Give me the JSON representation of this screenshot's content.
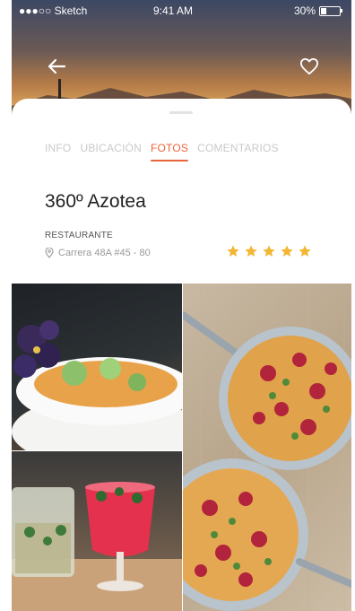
{
  "status_bar": {
    "carrier": "●●●○○ Sketch",
    "time": "9:41 AM",
    "battery": "30%",
    "battery_level": 0.3
  },
  "header": {
    "back_icon": "arrow-left-icon",
    "favorite_icon": "heart-outline-icon"
  },
  "tabs": [
    {
      "label": "INFO",
      "active": false
    },
    {
      "label": "UBICACIÓN",
      "active": false
    },
    {
      "label": "FOTOS",
      "active": true
    },
    {
      "label": "COMENTARIOS",
      "active": false
    }
  ],
  "venue": {
    "name": "360º Azotea",
    "category": "RESTAURANTE",
    "address": "Carrera 48A #45 - 80",
    "rating": 5,
    "rating_max": 5
  },
  "colors": {
    "accent": "#e8643b",
    "star": "#f2b632",
    "inactive_tab": "#c9c9c9"
  }
}
